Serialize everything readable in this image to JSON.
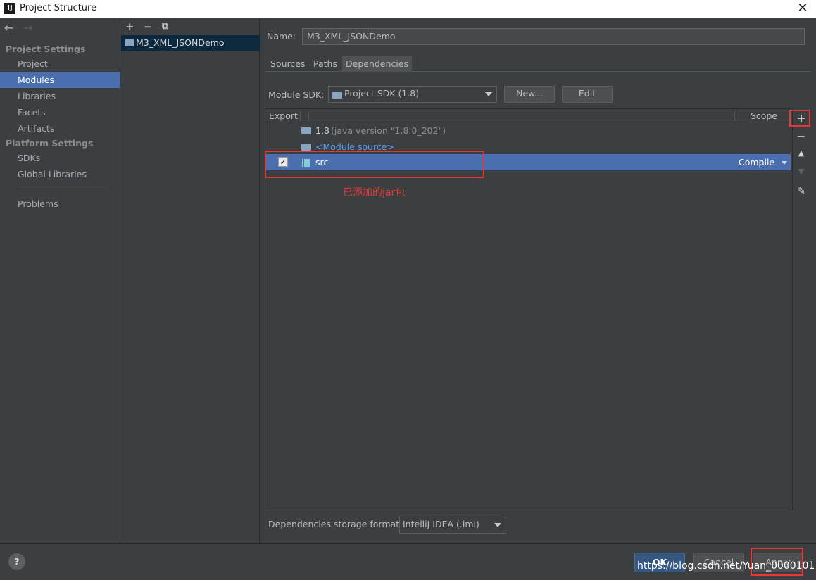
{
  "window": {
    "title": "Project Structure",
    "app_icon": "IJ"
  },
  "sidebar": {
    "project_settings_header": "Project Settings",
    "project_items": [
      "Project",
      "Modules",
      "Libraries",
      "Facets",
      "Artifacts"
    ],
    "platform_settings_header": "Platform Settings",
    "platform_items": [
      "SDKs",
      "Global Libraries"
    ],
    "problems": "Problems",
    "selected": "Modules"
  },
  "modules": {
    "list": [
      "M3_XML_JSONDemo"
    ]
  },
  "detail": {
    "name_label": "Name:",
    "name_value": "M3_XML_JSONDemo",
    "tabs": [
      "Sources",
      "Paths",
      "Dependencies"
    ],
    "active_tab": "Dependencies",
    "sdk_label": "Module SDK:",
    "sdk_value": "Project SDK (1.8)",
    "new_button": "New...",
    "edit_button": "Edit",
    "table": {
      "col_export": "Export",
      "col_scope": "Scope",
      "rows": [
        {
          "name": "1.8",
          "detail": "(java version \"1.8.0_202\")",
          "scope": ""
        },
        {
          "name": "<Module source>",
          "detail": "",
          "scope": ""
        },
        {
          "name": "src",
          "detail": "",
          "scope": "Compile",
          "checked": true
        }
      ]
    },
    "annotation": "已添加的jar包",
    "storage_label": "Dependencies storage format:",
    "storage_value": "IntelliJ IDEA (.iml)"
  },
  "footer": {
    "help": "?",
    "ok": "OK",
    "cancel": "Cancel",
    "apply": "Apply",
    "watermark": "https://blog.csdn.net/Yuan_0000101"
  },
  "colors": {
    "selection": "#4b6eaf",
    "highlight_box": "#e53935",
    "background": "#3c3f41"
  }
}
